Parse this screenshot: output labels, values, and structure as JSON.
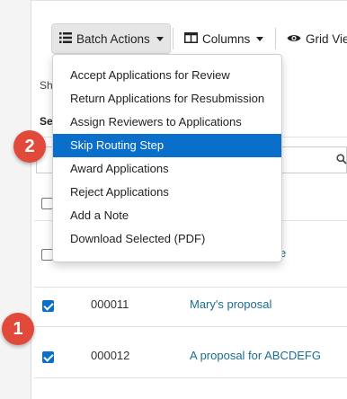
{
  "toolbar": {
    "batch_actions_label": "Batch Actions",
    "columns_label": "Columns",
    "grid_view_label": "Grid Vie"
  },
  "page_fragments": {
    "show_text": "Sh",
    "section_text": "Se",
    "link_fragment": "e"
  },
  "batch_menu": {
    "items": [
      "Accept Applications for Review",
      "Return Applications for Resubmission",
      "Assign Reviewers to Applications",
      "Skip Routing Step",
      "Award Applications",
      "Reject Applications",
      "Add a Note",
      "Download Selected (PDF)"
    ],
    "highlighted_index": 3
  },
  "table": {
    "rows": [
      {
        "checked": false,
        "id": "",
        "title": ""
      },
      {
        "checked": false,
        "id": "",
        "title": "e"
      },
      {
        "checked": true,
        "id": "000011",
        "title": "Mary's proposal"
      },
      {
        "checked": true,
        "id": "000012",
        "title": "A proposal for ABCDEFG"
      }
    ]
  },
  "callouts": {
    "step_one": "1",
    "step_two": "2"
  },
  "colors": {
    "highlight": "#0a6ecb",
    "badge": "#e14a3b",
    "link": "#1a6e8f"
  },
  "icons": {
    "batch": "list-icon",
    "columns": "columns-icon",
    "grid": "eye-icon",
    "search": "search-icon"
  }
}
